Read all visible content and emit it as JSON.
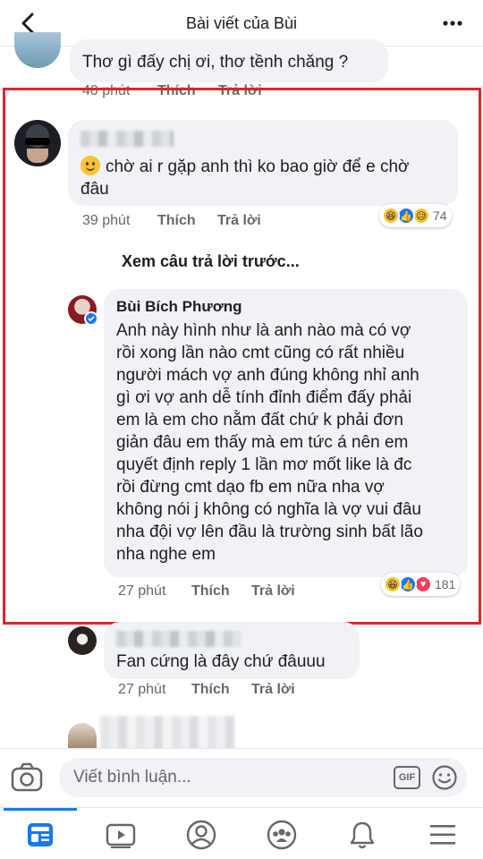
{
  "header": {
    "title": "Bài viết của Bùi"
  },
  "top_comment": {
    "text": "Thơ gì đấy chị ơi, thơ tềnh chăng ?",
    "time": "40 phút",
    "like": "Thích",
    "reply": "Trả lời"
  },
  "comment1": {
    "text_line1": "chờ ai r gặp anh thì ko bao giờ để e chờ",
    "text_line2": "đâu",
    "time": "39 phút",
    "like": "Thích",
    "reply": "Trả lời",
    "reaction_count": "74"
  },
  "view_previous": "Xem câu trả lời trước...",
  "reply1": {
    "author": "Bùi Bích Phương",
    "lines": [
      "Anh này hình như là anh nào mà có vợ",
      "rồi xong lần nào cmt cũng có rất nhiều",
      "người mách vợ anh đúng không nhỉ anh",
      "gì ơi vợ anh dễ tính đỉnh điểm đấy phải",
      "em là em cho nằm đất chứ k phải đơn",
      "giản đâu em thấy mà em tức á nên em",
      "quyết định reply 1 lần mơ mốt like là đc",
      "rồi đừng cmt dạo fb em nữa nha vợ",
      "không nói j không có nghĩa là vợ vui đâu",
      "nha đội vợ lên đầu là trường sinh bất lão",
      "nha nghe em"
    ],
    "time": "27 phút",
    "like": "Thích",
    "reply": "Trả lời",
    "reaction_count": "181"
  },
  "reply2": {
    "text": "Fan cứng là đây chứ đâuuu",
    "time": "27 phút",
    "like": "Thích",
    "reply": "Trả lời"
  },
  "composer": {
    "placeholder": "Viết bình luận...",
    "gif": "GIF"
  },
  "colors": {
    "accent": "#1877f2",
    "highlight_border": "#e0242b",
    "bubble": "#f0f2f5",
    "meta": "#65676b"
  },
  "icons": [
    "back-arrow-icon",
    "more-dots-icon",
    "camera-icon",
    "gif-icon",
    "smiley-icon",
    "feed-icon",
    "video-icon",
    "profile-icon",
    "groups-icon",
    "bell-icon",
    "menu-icon"
  ]
}
